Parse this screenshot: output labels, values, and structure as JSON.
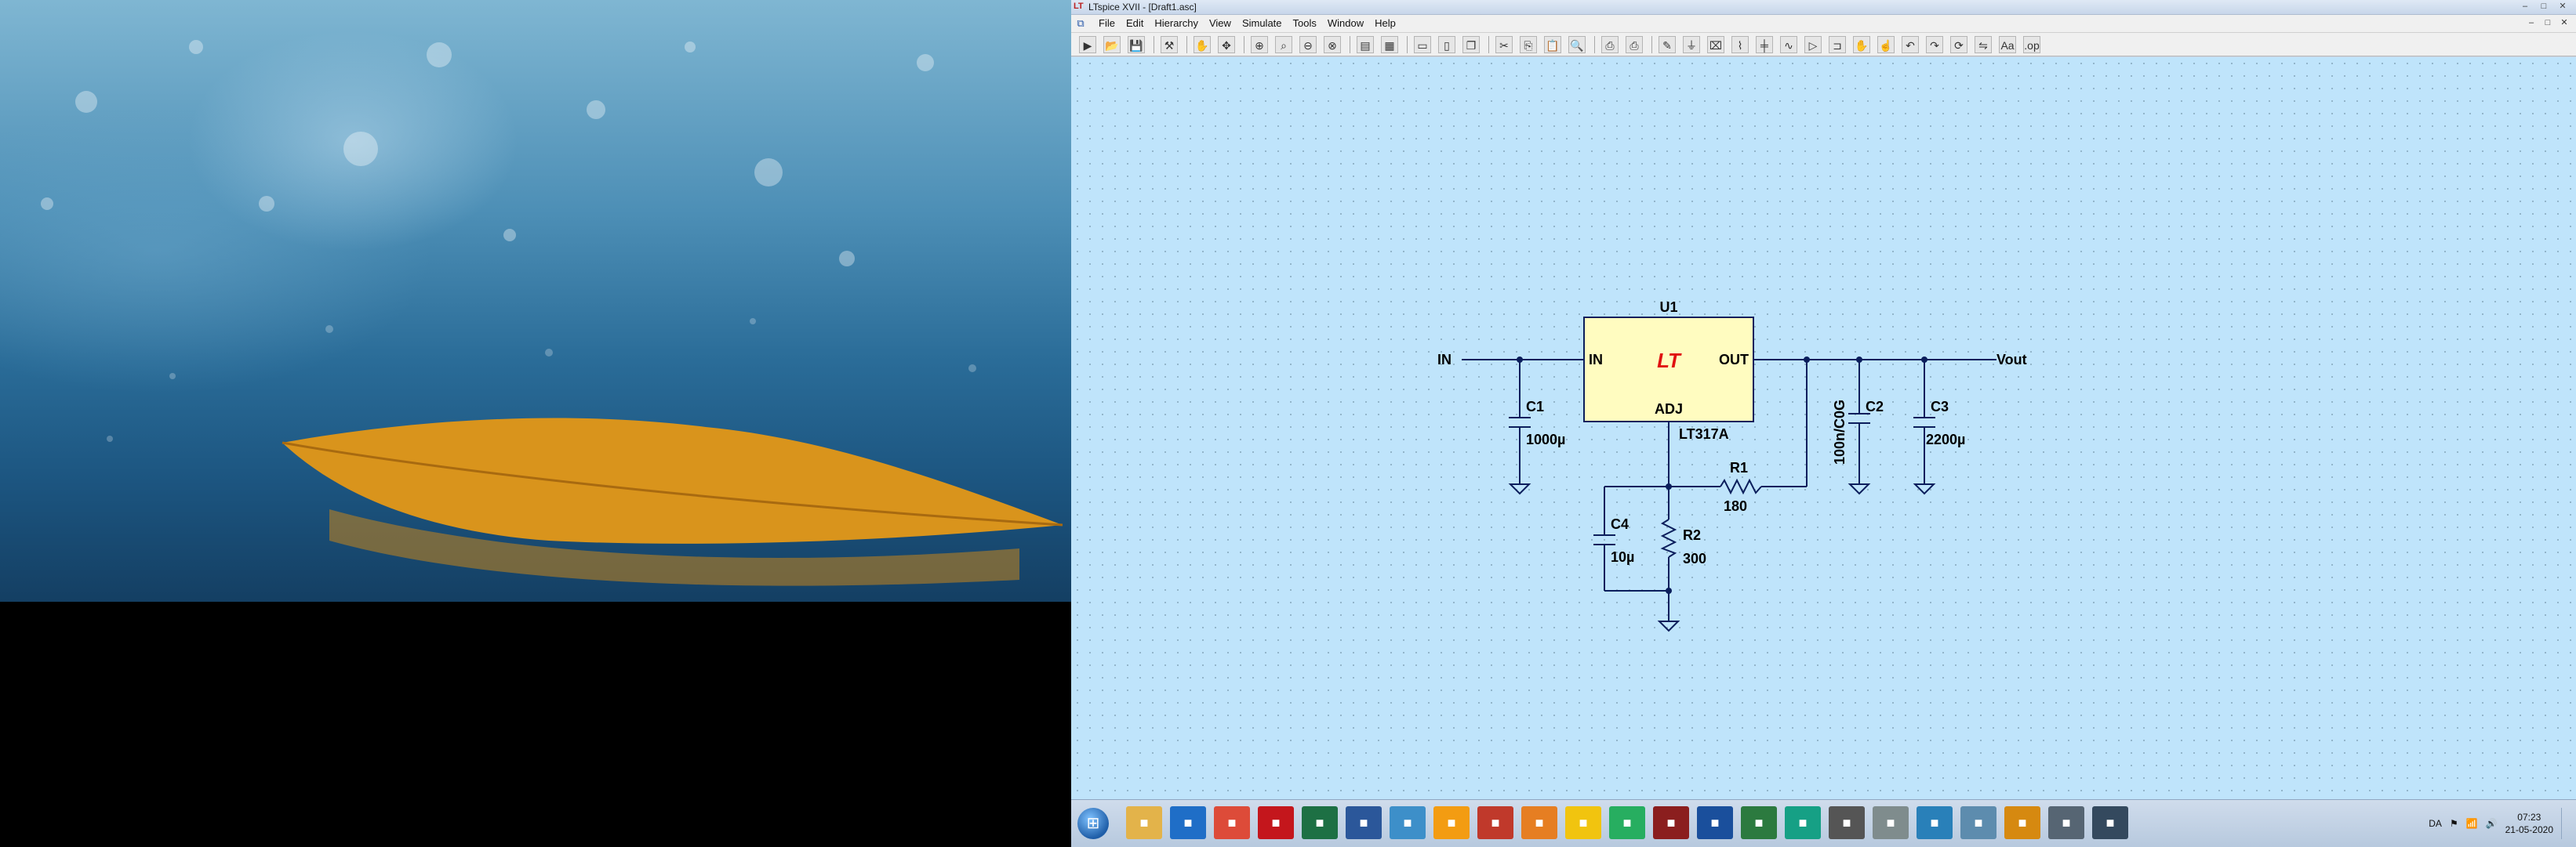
{
  "window": {
    "title": "LTspice XVII - [Draft1.asc]",
    "minimize": "–",
    "maximize": "□",
    "close": "✕"
  },
  "menu": [
    "File",
    "Edit",
    "Hierarchy",
    "View",
    "Simulate",
    "Tools",
    "Window",
    "Help"
  ],
  "toolbar_icons": [
    "run-icon",
    "open-icon",
    "save-icon",
    "control-panel-icon",
    "halt-icon",
    "pan-icon",
    "zoom-in-icon",
    "zoom-fit-icon",
    "zoom-out-icon",
    "zoom-cancel-icon",
    "autorange-icon",
    "mark-icon",
    "tile-horizontal-icon",
    "tile-vertical-icon",
    "cascade-icon",
    "cut-icon",
    "copy-icon",
    "paste-icon",
    "find-icon",
    "print-icon",
    "print-preview-icon",
    "wire-icon",
    "ground-icon",
    "label-icon",
    "resistor-icon",
    "capacitor-icon",
    "inductor-icon",
    "diode-icon",
    "component-icon",
    "move-icon",
    "drag-icon",
    "undo-icon",
    "redo-icon",
    "rotate-icon",
    "mirror-icon",
    "text-icon",
    "spice-directive-icon"
  ],
  "schematic": {
    "u1": {
      "ref": "U1",
      "part": "LT317A",
      "pin_in": "IN",
      "pin_out": "OUT",
      "pin_adj": "ADJ",
      "logo": "LT"
    },
    "net_in": "IN",
    "net_out": "Vout",
    "c1": {
      "ref": "C1",
      "value": "1000µ"
    },
    "c2": {
      "ref": "C2",
      "value": "100n/C0G"
    },
    "c3": {
      "ref": "C3",
      "value": "2200µ"
    },
    "c4": {
      "ref": "C4",
      "value": "10µ"
    },
    "r1": {
      "ref": "R1",
      "value": "180"
    },
    "r2": {
      "ref": "R2",
      "value": "300"
    }
  },
  "taskbar": {
    "apps": [
      {
        "icon": "explorer-icon",
        "color": "#e3b34a"
      },
      {
        "icon": "outlook-icon",
        "color": "#1f6ec7"
      },
      {
        "icon": "chrome-icon",
        "color": "#dd4b39"
      },
      {
        "icon": "acrobat-icon",
        "color": "#c4161c"
      },
      {
        "icon": "excel-icon",
        "color": "#1d7044"
      },
      {
        "icon": "word-icon",
        "color": "#2b579a"
      },
      {
        "icon": "pen-icon",
        "color": "#3d8fc9"
      },
      {
        "icon": "app-icon",
        "color": "#f39c12"
      },
      {
        "icon": "app-icon",
        "color": "#c0392b"
      },
      {
        "icon": "app-icon",
        "color": "#e67e22"
      },
      {
        "icon": "bulb-icon",
        "color": "#f1c40f"
      },
      {
        "icon": "app-icon",
        "color": "#27ae60"
      },
      {
        "icon": "ltspice-icon",
        "color": "#8b1e1e"
      },
      {
        "icon": "app-icon",
        "color": "#1a4f9c"
      },
      {
        "icon": "app-icon",
        "color": "#2c7a3f"
      },
      {
        "icon": "app-icon",
        "color": "#16a085"
      },
      {
        "icon": "app-icon",
        "color": "#555555"
      },
      {
        "icon": "app-icon",
        "color": "#7f8c8d"
      },
      {
        "icon": "app-icon",
        "color": "#2980b9"
      },
      {
        "icon": "app-icon",
        "color": "#5d8cae"
      },
      {
        "icon": "app-icon",
        "color": "#d68910"
      },
      {
        "icon": "app-icon",
        "color": "#566573"
      },
      {
        "icon": "app-icon",
        "color": "#34495e"
      }
    ],
    "language": "DA",
    "time": "07:23",
    "date": "21-05-2020"
  }
}
